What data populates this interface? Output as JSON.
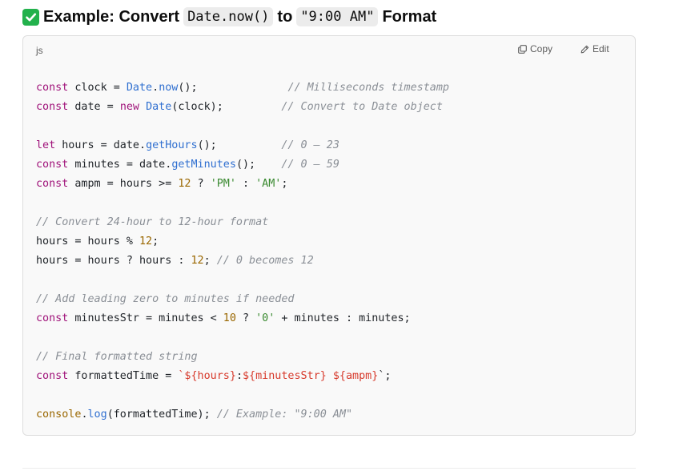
{
  "heading": {
    "check_glyph": "✓",
    "part1": "Example: Convert",
    "code1": "Date.now()",
    "part2": "to",
    "code2": "\"9:00 AM\"",
    "part3": "Format"
  },
  "code_block": {
    "language": "js",
    "copy_label": "Copy",
    "edit_label": "Edit",
    "lines": [
      [
        [
          "kw",
          "const"
        ],
        [
          "p",
          " clock = "
        ],
        [
          "fn",
          "Date"
        ],
        [
          "p",
          "."
        ],
        [
          "fn",
          "now"
        ],
        [
          "p",
          "();"
        ],
        [
          "p",
          "              "
        ],
        [
          "cmt",
          "// Milliseconds timestamp"
        ]
      ],
      [
        [
          "kw",
          "const"
        ],
        [
          "p",
          " date = "
        ],
        [
          "kw",
          "new"
        ],
        [
          "p",
          " "
        ],
        [
          "fn",
          "Date"
        ],
        [
          "p",
          "(clock);"
        ],
        [
          "p",
          "         "
        ],
        [
          "cmt",
          "// Convert to Date object"
        ]
      ],
      [],
      [
        [
          "kw",
          "let"
        ],
        [
          "p",
          " hours = date."
        ],
        [
          "fn",
          "getHours"
        ],
        [
          "p",
          "();"
        ],
        [
          "p",
          "          "
        ],
        [
          "cmt",
          "// 0 – 23"
        ]
      ],
      [
        [
          "kw",
          "const"
        ],
        [
          "p",
          " minutes = date."
        ],
        [
          "fn",
          "getMinutes"
        ],
        [
          "p",
          "();"
        ],
        [
          "p",
          "    "
        ],
        [
          "cmt",
          "// 0 – 59"
        ]
      ],
      [
        [
          "kw",
          "const"
        ],
        [
          "p",
          " ampm = hours >= "
        ],
        [
          "num",
          "12"
        ],
        [
          "p",
          " ? "
        ],
        [
          "str",
          "'PM'"
        ],
        [
          "p",
          " : "
        ],
        [
          "str",
          "'AM'"
        ],
        [
          "p",
          ";"
        ]
      ],
      [],
      [
        [
          "cmt",
          "// Convert 24-hour to 12-hour format"
        ]
      ],
      [
        [
          "p",
          "hours = hours % "
        ],
        [
          "num",
          "12"
        ],
        [
          "p",
          ";"
        ]
      ],
      [
        [
          "p",
          "hours = hours ? hours : "
        ],
        [
          "num",
          "12"
        ],
        [
          "p",
          "; "
        ],
        [
          "cmt",
          "// 0 becomes 12"
        ]
      ],
      [],
      [
        [
          "cmt",
          "// Add leading zero to minutes if needed"
        ]
      ],
      [
        [
          "kw",
          "const"
        ],
        [
          "p",
          " minutesStr = minutes < "
        ],
        [
          "num",
          "10"
        ],
        [
          "p",
          " ? "
        ],
        [
          "str",
          "'0'"
        ],
        [
          "p",
          " + minutes : minutes;"
        ]
      ],
      [],
      [
        [
          "cmt",
          "// Final formatted string"
        ]
      ],
      [
        [
          "kw",
          "const"
        ],
        [
          "p",
          " formattedTime = "
        ],
        [
          "tpl",
          "`${hours}"
        ],
        [
          "p",
          ":"
        ],
        [
          "tpl",
          "${minutesStr}"
        ],
        [
          "p",
          " "
        ],
        [
          "tpl",
          "${ampm}"
        ],
        [
          "p",
          "`;"
        ]
      ],
      [],
      [
        [
          "obj",
          "console"
        ],
        [
          "p",
          "."
        ],
        [
          "fn",
          "log"
        ],
        [
          "p",
          "(formattedTime); "
        ],
        [
          "cmt",
          "// Example: \"9:00 AM\""
        ]
      ]
    ]
  }
}
